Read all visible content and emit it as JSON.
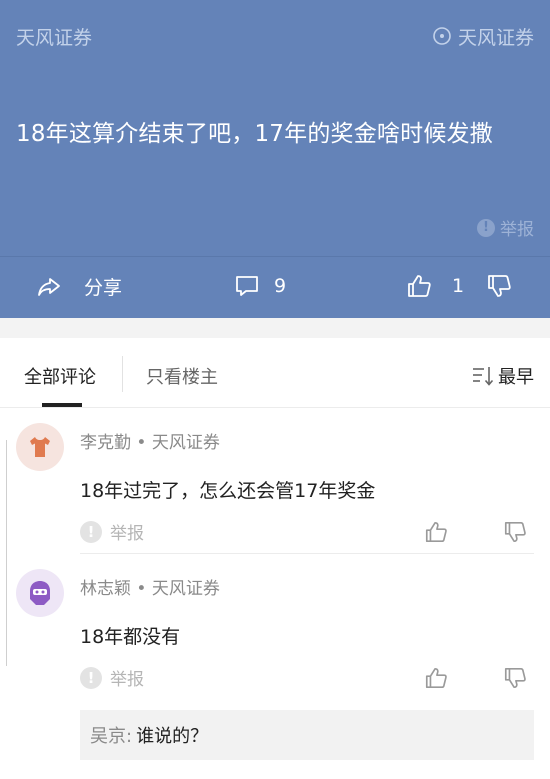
{
  "post": {
    "company_left": "天风证券",
    "company_right": "天风证券",
    "text": "18年这算介结束了吧，17年的奖金啥时候发撒",
    "report_label": "举报",
    "share_label": "分享",
    "comment_count": "9",
    "like_count": "1"
  },
  "tabs": {
    "all_label": "全部评论",
    "owner_only_label": "只看楼主",
    "sort_label": "最早"
  },
  "comments": [
    {
      "author": "李克勤 • 天风证券",
      "text": "18年过完了，怎么还会管17年奖金",
      "report_label": "举报"
    },
    {
      "author": "林志颖 • 天风证券",
      "text": "18年都没有",
      "report_label": "举报",
      "reply": {
        "name": "吴京:",
        "text": "谁说的？"
      }
    }
  ],
  "colors": {
    "post_background": "#6483b8",
    "avatar1_icon": "#e07a4f",
    "avatar2_icon": "#8d5bc4"
  }
}
